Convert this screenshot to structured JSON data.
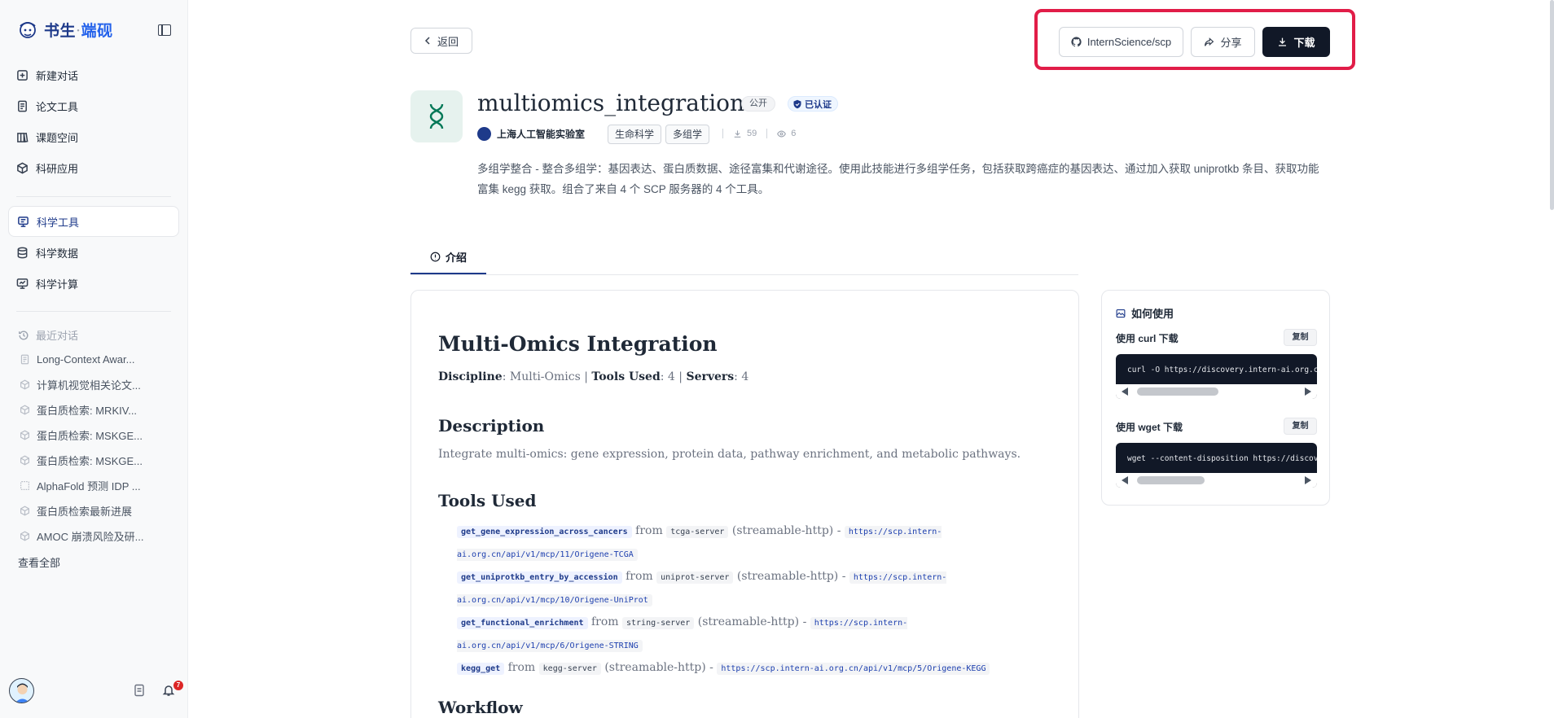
{
  "brand": {
    "name": "书生",
    "dot": "·",
    "accent": "端砚"
  },
  "sidebar": {
    "nav_primary": [
      {
        "label": "新建对话",
        "icon": "plus-square-icon"
      },
      {
        "label": "论文工具",
        "icon": "document-icon"
      },
      {
        "label": "课题空间",
        "icon": "book-icon"
      },
      {
        "label": "科研应用",
        "icon": "cube-icon"
      }
    ],
    "nav_secondary": [
      {
        "label": "科学工具",
        "icon": "flask-icon",
        "active": true
      },
      {
        "label": "科学数据",
        "icon": "database-icon"
      },
      {
        "label": "科学计算",
        "icon": "monitor-icon"
      }
    ],
    "recent_title": "最近对话",
    "recent": [
      {
        "label": "Long-Context Awar...",
        "icon": "document-icon"
      },
      {
        "label": "计算机视觉相关论文...",
        "icon": "cube-icon"
      },
      {
        "label": "蛋白质检索: MRKIV...",
        "icon": "cube-icon"
      },
      {
        "label": "蛋白质检索: MSKGE...",
        "icon": "cube-icon"
      },
      {
        "label": "蛋白质检索: MSKGE...",
        "icon": "cube-icon"
      },
      {
        "label": "AlphaFold 预测 IDP ...",
        "icon": "grid-icon"
      },
      {
        "label": "蛋白质检索最新进展",
        "icon": "cube-icon"
      },
      {
        "label": "AMOC 崩溃风险及研...",
        "icon": "cube-icon"
      }
    ],
    "view_all": "查看全部",
    "notification_count": "7"
  },
  "header": {
    "back_label": "返回",
    "repo_label": "InternScience/scp",
    "share_label": "分享",
    "download_label": "下载"
  },
  "skill": {
    "title": "multiomics_integration",
    "visibility": "公开",
    "verified": "已认证",
    "org": "上海人工智能实验室",
    "tags": [
      "生命科学",
      "多组学"
    ],
    "downloads": "59",
    "views": "6",
    "description": "多组学整合 - 整合多组学：基因表达、蛋白质数据、途径富集和代谢途径。使用此技能进行多组学任务，包括获取跨癌症的基因表达、通过加入获取 uniprotkb 条目、获取功能富集 kegg 获取。组合了来自 4 个 SCP 服务器的 4 个工具。"
  },
  "tabs": {
    "intro": "介绍"
  },
  "doc": {
    "h1": "Multi-Omics Integration",
    "meta": {
      "discipline_label": "Discipline",
      "discipline_value": ": Multi-Omics | ",
      "tools_label": "Tools Used",
      "tools_value": ": 4 | ",
      "servers_label": "Servers",
      "servers_value": ": 4"
    },
    "description_heading": "Description",
    "description_text": "Integrate multi-omics: gene expression, protein data, pathway enrichment, and metabolic pathways.",
    "tools_heading": "Tools Used",
    "tools": [
      {
        "name": "get_gene_expression_across_cancers",
        "server": "tcga-server",
        "transport": "(streamable-http)",
        "url": "https://scp.intern-ai.org.cn/api/v1/mcp/11/Origene-TCGA"
      },
      {
        "name": "get_uniprotkb_entry_by_accession",
        "server": "uniprot-server",
        "transport": "(streamable-http)",
        "url": "https://scp.intern-ai.org.cn/api/v1/mcp/10/Origene-UniProt"
      },
      {
        "name": "get_functional_enrichment",
        "server": "string-server",
        "transport": "(streamable-http)",
        "url": "https://scp.intern-ai.org.cn/api/v1/mcp/6/Origene-STRING"
      },
      {
        "name": "kegg_get",
        "server": "kegg-server",
        "transport": "(streamable-http)",
        "url": "https://scp.intern-ai.org.cn/api/v1/mcp/5/Origene-KEGG"
      }
    ],
    "from_word": "from",
    "dash": "-",
    "workflow_heading": "Workflow"
  },
  "how_to_use": {
    "title": "如何使用",
    "curl_label": "使用 curl 下载",
    "curl_cmd": "curl -O https://discovery.intern-ai.org.cn/d",
    "wget_label": "使用 wget 下载",
    "wget_cmd": "wget --content-disposition https://discovery",
    "copy_label": "复制"
  },
  "colors": {
    "accent": "#1e3a8a",
    "highlight": "#e11d48",
    "dark_button": "#111827"
  }
}
